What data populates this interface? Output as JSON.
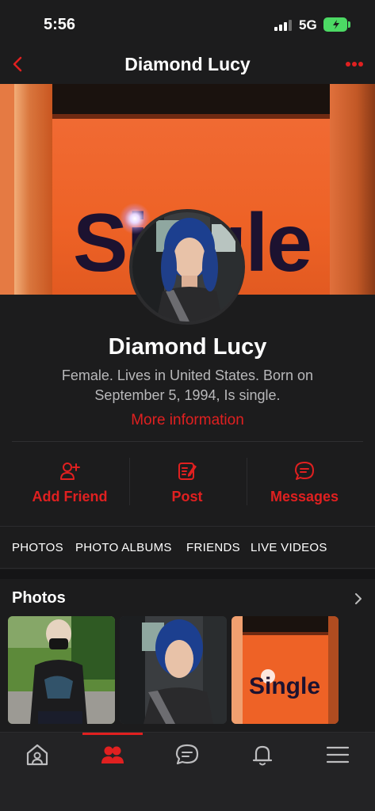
{
  "status_bar": {
    "time": "5:56",
    "network": "5G"
  },
  "nav": {
    "title": "Diamond Lucy"
  },
  "cover": {
    "word": "Single"
  },
  "profile": {
    "name": "Diamond Lucy",
    "bio": "Female. Lives in United States. Born on September 5, 1994, Is single.",
    "more_info": "More information"
  },
  "actions": [
    {
      "label": "Add Friend",
      "icon": "add-friend-icon"
    },
    {
      "label": "Post",
      "icon": "post-icon"
    },
    {
      "label": "Messages",
      "icon": "messages-icon"
    }
  ],
  "tabs": [
    "PHOTOS",
    "PHOTO ALBUMS",
    "FRIENDS",
    "LIVE VIDEOS"
  ],
  "photos": {
    "title": "Photos",
    "thumb_3_word": "Single"
  },
  "bottom_nav": [
    {
      "icon": "home-icon",
      "active": false
    },
    {
      "icon": "friends-icon",
      "active": true
    },
    {
      "icon": "chat-icon",
      "active": false
    },
    {
      "icon": "bell-icon",
      "active": false
    },
    {
      "icon": "menu-icon",
      "active": false
    }
  ],
  "colors": {
    "accent": "#e02020",
    "background": "#1c1c1d",
    "battery": "#4cd964"
  }
}
